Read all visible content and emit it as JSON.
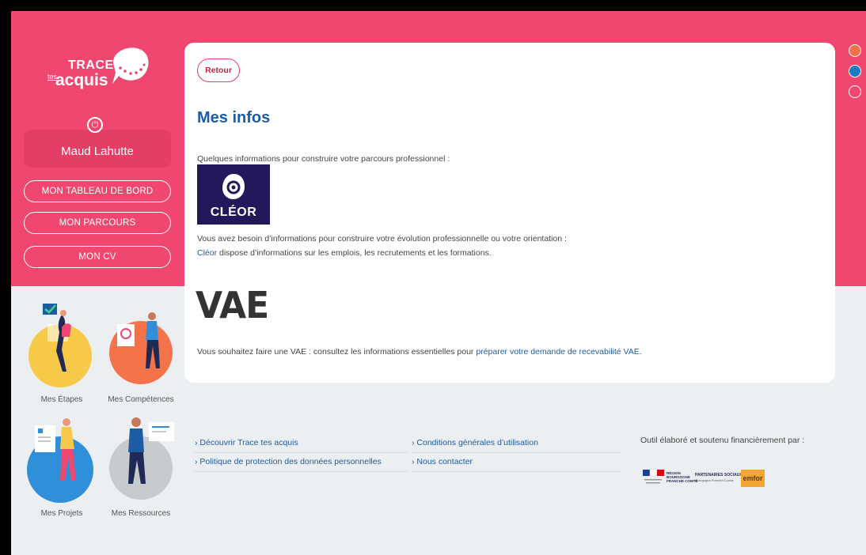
{
  "brand": {
    "name_top": "TRACE",
    "name_small": "tes",
    "name_bottom": "acquis"
  },
  "user": {
    "name": "Maud Lahutte"
  },
  "nav": [
    {
      "label": "MON TABLEAU DE BORD"
    },
    {
      "label": "MON PARCOURS"
    },
    {
      "label": "MON CV"
    }
  ],
  "tiles": [
    {
      "label": "Mes Étapes",
      "color": "#f7c948"
    },
    {
      "label": "Mes Compétences",
      "color": "#f4734a"
    },
    {
      "label": "Mes Projets",
      "color": "#2f8fd8"
    },
    {
      "label": "Mes Ressources",
      "color": "#c8cbcd"
    }
  ],
  "card": {
    "back_label": "Retour",
    "title": "Mes infos",
    "intro": "Quelques informations pour construire votre parcours professionnel :",
    "cleor_logo_text": "CLÉOR",
    "cleor_line1": "Vous avez besoin d’informations pour construire votre évolution professionnelle ou votre orientation :",
    "cleor_link": "Cléor",
    "cleor_line2_rest": " dispose d’informations sur les emplois, les recrutements et les formations.",
    "vae_logo_text": "VAE",
    "vae_line_prefix": "Vous souhaitez faire une VAE : consultez les informations essentielles pour ",
    "vae_link": "préparer votre demande de recevabilité VAE",
    "vae_line_suffix": "."
  },
  "footer": {
    "links": [
      "› Découvrir Trace tes acquis",
      "› Politique de protection des données personnelles",
      "› Conditions générales d’utilisation",
      "› Nous contacter"
    ],
    "funder_text": "Outil élaboré et soutenu financièrement par :",
    "partner_logos": {
      "region": "RÉGION BOURGOGNE FRANCHE COMTÉ",
      "partners": "PARTENAIRES SOCIAUX",
      "partners_sub": "Bourgogne-Franche-Comté",
      "emfor": "emfor"
    }
  },
  "colors": {
    "brand_pink": "#ef476f",
    "brand_blue": "#1d5ca3"
  },
  "theme_dots": [
    {
      "color": "#f4734a",
      "style": "filled"
    },
    {
      "color": "#1a7cc1",
      "style": "filled"
    },
    {
      "color": "#ffffff",
      "style": "outline"
    }
  ]
}
